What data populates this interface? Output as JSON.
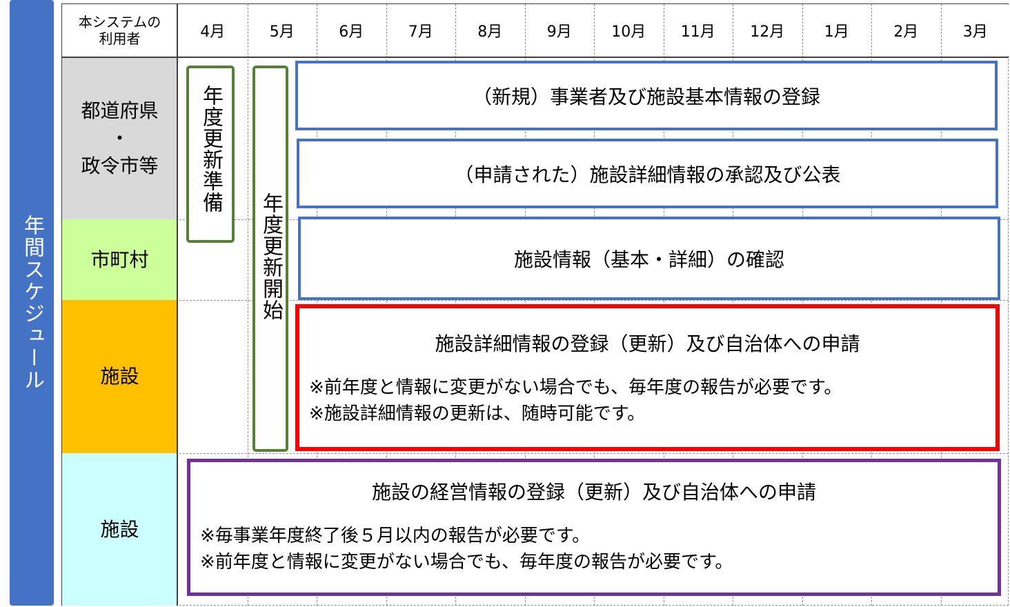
{
  "side_label": "年間スケジュール",
  "header": {
    "corner_line1": "本システムの",
    "corner_line2": "利用者",
    "months": [
      "4月",
      "5月",
      "6月",
      "7月",
      "8月",
      "9月",
      "10月",
      "11月",
      "12月",
      "1月",
      "2月",
      "3月"
    ]
  },
  "rows": {
    "pref_line1": "都道府県",
    "pref_line2": "・",
    "pref_line3": "政令市等",
    "municipality": "市町村",
    "facility1": "施設",
    "facility2": "施設"
  },
  "colors": {
    "pref": "#D9D9D9",
    "municipality": "#CCFF99",
    "facility1": "#FFC000",
    "facility2": "#CCFFFF",
    "side": "#4472C4"
  },
  "vertical_boxes": {
    "prep": "年度更新準備",
    "start": "年度更新開始"
  },
  "boxes": {
    "b1": "（新規）事業者及び施設基本情報の登録",
    "b2": "（申請された）施設詳細情報の承認及び公表",
    "b3": "施設情報（基本・詳細）の確認",
    "b4_title": "施設詳細情報の登録（更新）及び自治体への申請",
    "b4_notes": [
      "※前年度と情報に変更がない場合でも、毎年度の報告が必要です。",
      "※施設詳細情報の更新は、随時可能です。"
    ],
    "b5_title": "施設の経営情報の登録（更新）及び自治体への申請",
    "b5_notes": [
      "※毎事業年度終了後５月以内の報告が必要です。",
      "※前年度と情報に変更がない場合でも、毎年度の報告が必要です。"
    ]
  }
}
